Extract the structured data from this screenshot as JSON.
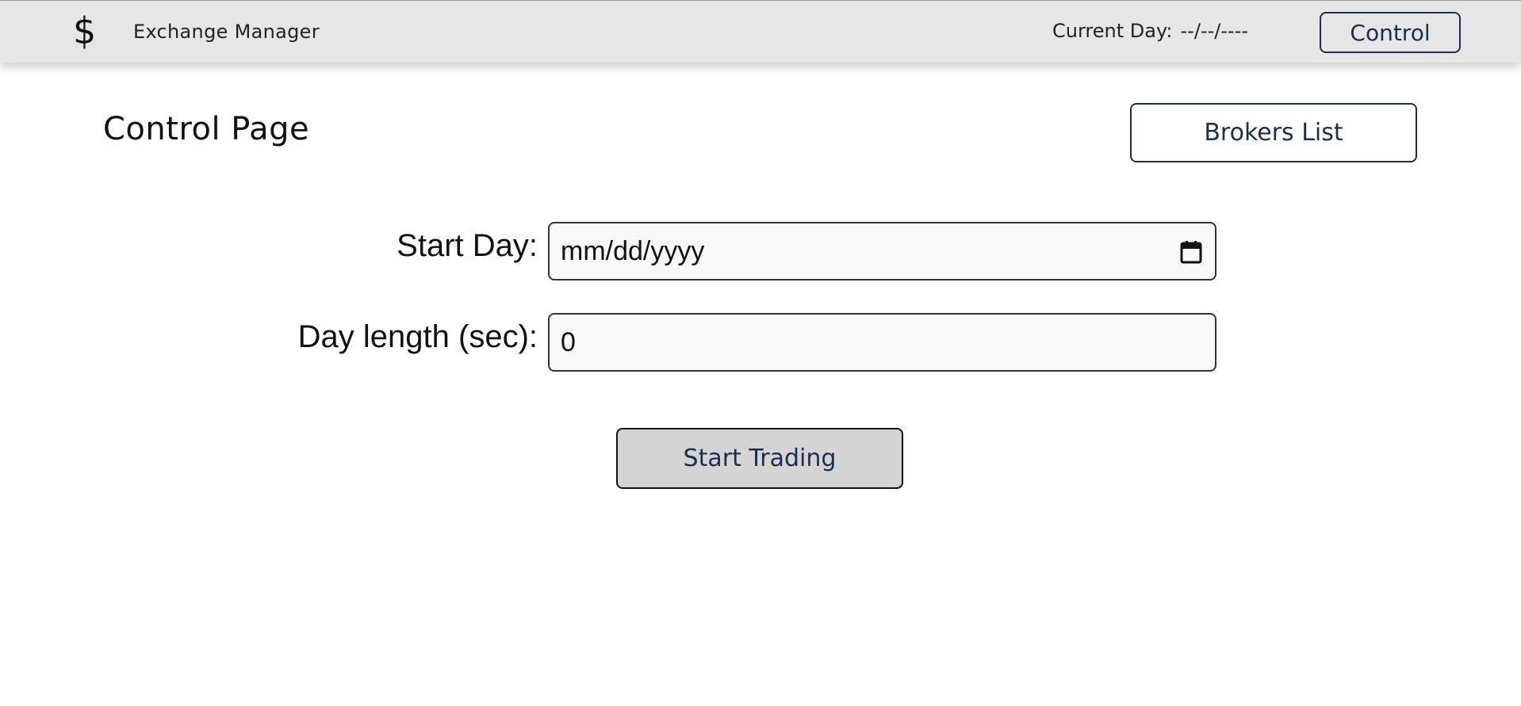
{
  "navbar": {
    "brand_icon": "$",
    "brand_title": "Exchange Manager",
    "current_day_label": "Current Day:",
    "current_day_value": "--/--/----",
    "control_label": "Control"
  },
  "page": {
    "title": "Control Page",
    "brokers_button": "Brokers List"
  },
  "form": {
    "start_day_label": "Start Day:",
    "start_day_value": "mm/dd/yyyy",
    "day_length_label": "Day length (sec):",
    "day_length_value": "0",
    "submit_label": "Start Trading"
  },
  "colors": {
    "navbar_bg": "#e6e6e6",
    "accent": "#1c2e50",
    "button_bg": "#d4d4d4"
  },
  "icons": {
    "brand": "dollar-icon",
    "date_picker": "calendar-icon"
  }
}
